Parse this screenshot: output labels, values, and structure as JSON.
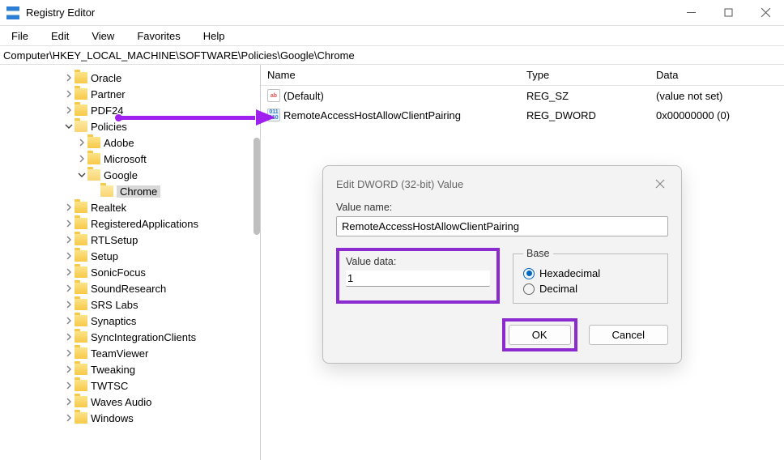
{
  "app": {
    "title": "Registry Editor"
  },
  "menu": {
    "file": "File",
    "edit": "Edit",
    "view": "View",
    "favorites": "Favorites",
    "help": "Help"
  },
  "address": {
    "path": "Computer\\HKEY_LOCAL_MACHINE\\SOFTWARE\\Policies\\Google\\Chrome"
  },
  "tree": {
    "items": [
      {
        "depth": 3,
        "chev": "right",
        "label": "Oracle"
      },
      {
        "depth": 3,
        "chev": "right",
        "label": "Partner"
      },
      {
        "depth": 3,
        "chev": "right",
        "label": "PDF24"
      },
      {
        "depth": 3,
        "chev": "down",
        "label": "Policies",
        "open": true
      },
      {
        "depth": 4,
        "chev": "right",
        "label": "Adobe"
      },
      {
        "depth": 4,
        "chev": "right",
        "label": "Microsoft"
      },
      {
        "depth": 4,
        "chev": "down",
        "label": "Google",
        "open": true
      },
      {
        "depth": 5,
        "chev": "none",
        "label": "Chrome",
        "selected": true,
        "open": true
      },
      {
        "depth": 3,
        "chev": "right",
        "label": "Realtek"
      },
      {
        "depth": 3,
        "chev": "right",
        "label": "RegisteredApplications"
      },
      {
        "depth": 3,
        "chev": "right",
        "label": "RTLSetup"
      },
      {
        "depth": 3,
        "chev": "right",
        "label": "Setup"
      },
      {
        "depth": 3,
        "chev": "right",
        "label": "SonicFocus"
      },
      {
        "depth": 3,
        "chev": "right",
        "label": "SoundResearch"
      },
      {
        "depth": 3,
        "chev": "right",
        "label": "SRS Labs"
      },
      {
        "depth": 3,
        "chev": "right",
        "label": "Synaptics"
      },
      {
        "depth": 3,
        "chev": "right",
        "label": "SyncIntegrationClients"
      },
      {
        "depth": 3,
        "chev": "right",
        "label": "TeamViewer"
      },
      {
        "depth": 3,
        "chev": "right",
        "label": "Tweaking"
      },
      {
        "depth": 3,
        "chev": "right",
        "label": "TWTSC"
      },
      {
        "depth": 3,
        "chev": "right",
        "label": "Waves Audio"
      },
      {
        "depth": 3,
        "chev": "right",
        "label": "Windows"
      }
    ]
  },
  "list": {
    "headers": {
      "name": "Name",
      "type": "Type",
      "data": "Data"
    },
    "rows": [
      {
        "icon": "sz",
        "name": "(Default)",
        "type": "REG_SZ",
        "data": "(value not set)"
      },
      {
        "icon": "dw",
        "name": "RemoteAccessHostAllowClientPairing",
        "type": "REG_DWORD",
        "data": "0x00000000 (0)"
      }
    ]
  },
  "dialog": {
    "title": "Edit DWORD (32-bit) Value",
    "value_name_label": "Value name:",
    "value_name": "RemoteAccessHostAllowClientPairing",
    "value_data_label": "Value data:",
    "value_data": "1",
    "base_label": "Base",
    "hex_label": "Hexadecimal",
    "dec_label": "Decimal",
    "ok": "OK",
    "cancel": "Cancel"
  }
}
